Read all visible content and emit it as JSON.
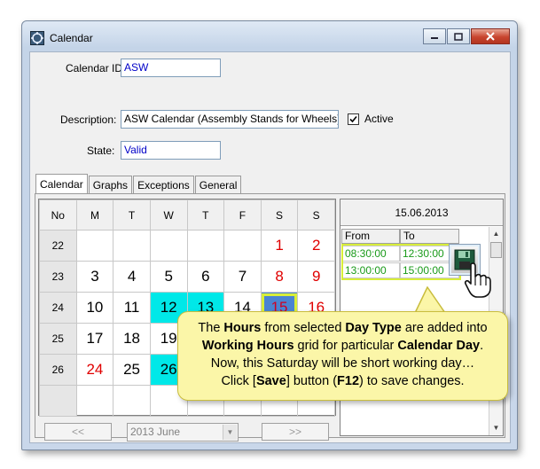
{
  "window": {
    "title": "Calendar"
  },
  "form": {
    "calendar_id_label": "Calendar ID:",
    "calendar_id_value": "ASW",
    "description_label": "Description:",
    "description_value": "ASW Calendar (Assembly Stands for Wheels)",
    "active_label": "Active",
    "active_checked": true,
    "state_label": "State:",
    "state_value": "Valid"
  },
  "tabs": [
    "Calendar",
    "Graphs",
    "Exceptions",
    "General"
  ],
  "calendar": {
    "headers": [
      "No",
      "M",
      "T",
      "W",
      "T",
      "F",
      "S",
      "S"
    ],
    "rows": [
      {
        "no": "22",
        "days": [
          "",
          "",
          "",
          "",
          "",
          "1",
          "2"
        ]
      },
      {
        "no": "23",
        "days": [
          "3",
          "4",
          "5",
          "6",
          "7",
          "8",
          "9"
        ]
      },
      {
        "no": "24",
        "days": [
          "10",
          "11",
          "12",
          "13",
          "14",
          "15",
          "16"
        ]
      },
      {
        "no": "25",
        "days": [
          "17",
          "18",
          "19",
          "",
          "",
          "",
          ""
        ]
      },
      {
        "no": "26",
        "days": [
          "24",
          "25",
          "26",
          "",
          "",
          "",
          ""
        ]
      }
    ],
    "prev_label": "<<",
    "next_label": ">>",
    "month_value": "2013 June"
  },
  "hours": {
    "date": "15.06.2013",
    "col_from": "From",
    "col_to": "To",
    "rows": [
      {
        "from": "08:30:00",
        "to": "12:30:00"
      },
      {
        "from": "13:00:00",
        "to": "15:00:00"
      }
    ]
  },
  "callout": {
    "l1_a": "The ",
    "l1_b": "Hours",
    "l1_c": " from selected ",
    "l1_d": "Day Type",
    "l1_e": " are added into",
    "l2_a": "Working Hours",
    "l2_b": " grid for particular ",
    "l2_c": "Calendar Day",
    "l3": "Now, this Saturday will be short working day…",
    "l4_a": "Click [",
    "l4_b": "Save",
    "l4_c": "] button (",
    "l4_d": "F12",
    "l4_e": ") to save changes."
  },
  "colors": {
    "highlight_cyan": "#00e8e8",
    "selected_day": "#4a84d2",
    "weekend_red": "#e00000",
    "hours_text": "#1a9a1a",
    "callout_bg": "#fbf6a8"
  }
}
